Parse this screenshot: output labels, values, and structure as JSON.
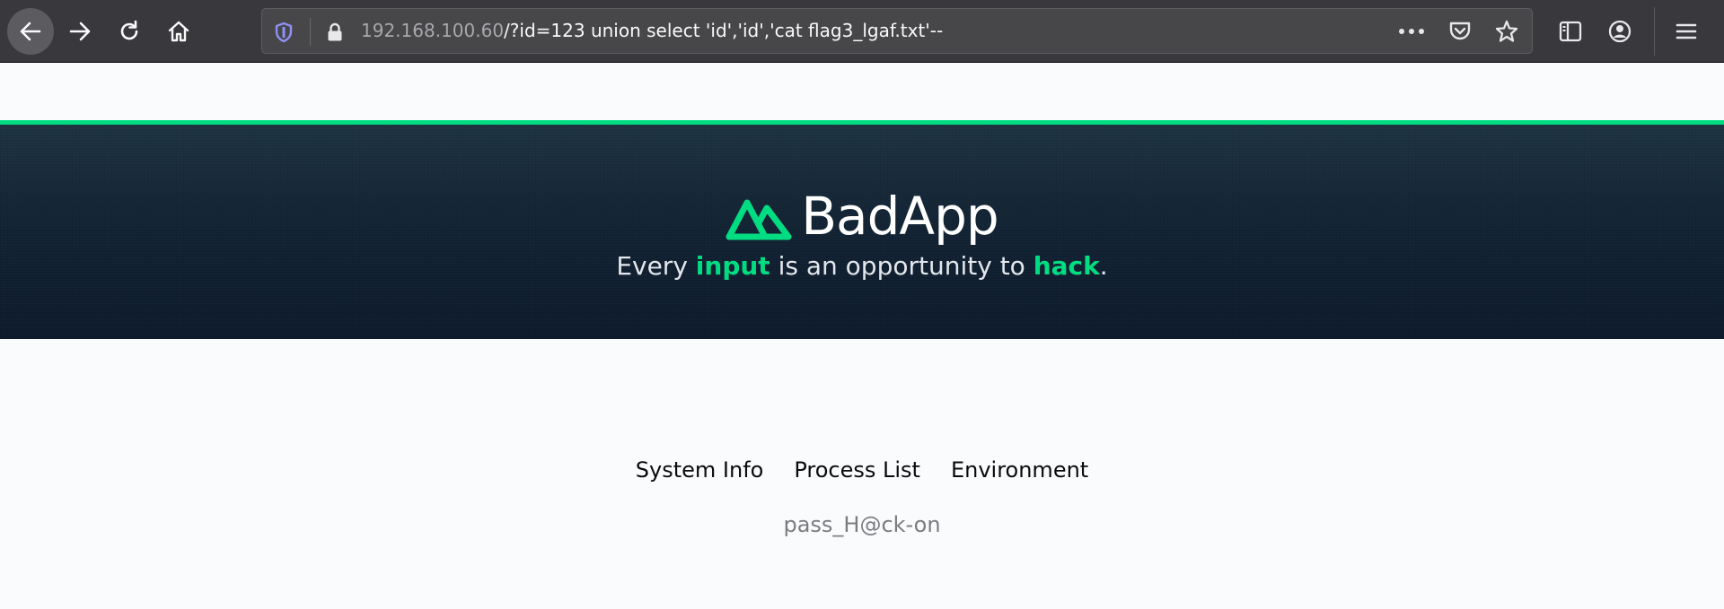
{
  "browser": {
    "url_host": "192.168.100.60",
    "url_path": "/?id=123 union select 'id','id','cat flag3_lgaf.txt'--",
    "colors": {
      "toolbar": "#38383d",
      "urlbar": "#474749",
      "shield": "#8f8ff5"
    }
  },
  "page": {
    "brand_name": "BadApp",
    "tagline": {
      "part1": "Every ",
      "highlight1": "input",
      "part2": " is an opportunity to ",
      "highlight2": "hack",
      "part3": "."
    },
    "nav_links": [
      {
        "label": "System Info"
      },
      {
        "label": "Process List"
      },
      {
        "label": "Environment"
      }
    ],
    "pass_text": "pass_H@ck-on",
    "colors": {
      "accent": "#00dc82",
      "hero_top": "#1d3342",
      "hero_bottom": "#0d1a2c"
    }
  },
  "icons": {
    "back": "arrow-left-icon",
    "forward": "arrow-right-icon",
    "reload": "reload-icon",
    "home": "home-icon",
    "tracking": "shield-icon",
    "secure": "lock-icon",
    "more": "ellipsis-icon",
    "pocket": "pocket-icon",
    "bookmark": "star-icon",
    "sidebar": "sidebar-icon",
    "account": "account-icon",
    "menu": "hamburger-menu-icon"
  }
}
